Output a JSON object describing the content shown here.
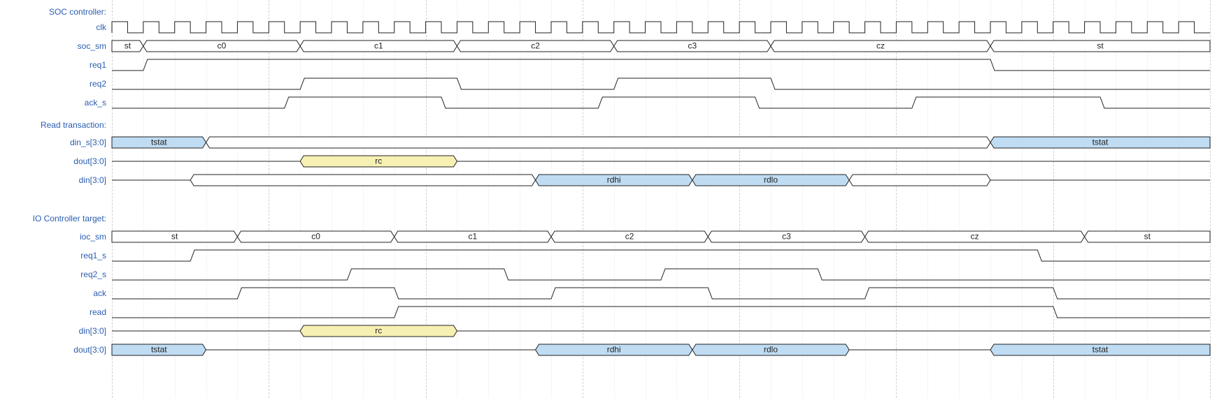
{
  "chart_data": {
    "type": "timing-diagram",
    "clock_cycles": 35,
    "labels": {
      "soc_heading": "SOC controller:",
      "clk": "clk",
      "soc_sm": "soc_sm",
      "req1": "req1",
      "req2": "req2",
      "ack_s": "ack_s",
      "read_txn_heading": "Read transaction:",
      "din_s": "din_s[3:0]",
      "dout": "dout[3:0]",
      "din": "din[3:0]",
      "ioc_heading": "IO Controller target:",
      "ioc_sm": "ioc_sm",
      "req1_s": "req1_s",
      "req2_s": "req2_s",
      "ack": "ack",
      "read": "read",
      "din2": "din[3:0]",
      "dout2": "dout[3:0]"
    },
    "soc_sm_segments": [
      {
        "end": 1,
        "label": "st"
      },
      {
        "end": 6,
        "label": "c0"
      },
      {
        "end": 11,
        "label": "c1"
      },
      {
        "end": 16,
        "label": "c2"
      },
      {
        "end": 21,
        "label": "c3"
      },
      {
        "end": 28,
        "label": "cz"
      },
      {
        "end": 35,
        "label": "st"
      }
    ],
    "ioc_sm_segments": [
      {
        "end": 4,
        "label": "st"
      },
      {
        "end": 9,
        "label": "c0"
      },
      {
        "end": 14,
        "label": "c1"
      },
      {
        "end": 19,
        "label": "c2"
      },
      {
        "end": 24,
        "label": "c3"
      },
      {
        "end": 31,
        "label": "cz"
      },
      {
        "end": 35,
        "label": "st"
      }
    ],
    "din_s_segments": [
      {
        "start": 0,
        "end": 3,
        "label": "tstat",
        "fill": "blue"
      },
      {
        "start": 3,
        "end": 28,
        "label": "",
        "fill": "none"
      },
      {
        "start": 28,
        "end": 35,
        "label": "tstat",
        "fill": "blue"
      }
    ],
    "dout_segments": [
      {
        "start": 0,
        "end": 6,
        "label": "",
        "fill": "flat"
      },
      {
        "start": 6,
        "end": 11,
        "label": "rc",
        "fill": "yellow"
      },
      {
        "start": 11,
        "end": 35,
        "label": "",
        "fill": "flat"
      }
    ],
    "din_segments": [
      {
        "start": 0,
        "end": 2.5,
        "label": "",
        "fill": "flat"
      },
      {
        "start": 2.5,
        "end": 13.5,
        "label": "",
        "fill": "none"
      },
      {
        "start": 13.5,
        "end": 18.5,
        "label": "rdhi",
        "fill": "blue"
      },
      {
        "start": 18.5,
        "end": 23.5,
        "label": "rdlo",
        "fill": "blue"
      },
      {
        "start": 23.5,
        "end": 28,
        "label": "",
        "fill": "none"
      },
      {
        "start": 28,
        "end": 35,
        "label": "",
        "fill": "flat"
      }
    ],
    "din2_segments": [
      {
        "start": 0,
        "end": 6,
        "label": "",
        "fill": "flat"
      },
      {
        "start": 6,
        "end": 11,
        "label": "rc",
        "fill": "yellow"
      },
      {
        "start": 11,
        "end": 35,
        "label": "",
        "fill": "flat"
      }
    ],
    "dout2_segments": [
      {
        "start": 0,
        "end": 3,
        "label": "tstat",
        "fill": "blue"
      },
      {
        "start": 3,
        "end": 13.5,
        "label": "",
        "fill": "flat"
      },
      {
        "start": 13.5,
        "end": 18.5,
        "label": "rdhi",
        "fill": "blue"
      },
      {
        "start": 18.5,
        "end": 23.5,
        "label": "rdlo",
        "fill": "blue"
      },
      {
        "start": 23.5,
        "end": 28,
        "label": "",
        "fill": "flat"
      },
      {
        "start": 28,
        "end": 35,
        "label": "tstat",
        "fill": "blue"
      }
    ],
    "sig_req1": {
      "start_low": 0,
      "rise": 1,
      "fall": 28
    },
    "sig_req2": {
      "pulses": [
        [
          6,
          11
        ],
        [
          16,
          21
        ]
      ]
    },
    "sig_ack_s": {
      "pulses": [
        [
          5.5,
          10.5
        ],
        [
          15.5,
          20.5
        ],
        [
          25.5,
          31.5
        ]
      ]
    },
    "sig_req1_s": {
      "start_low": 0,
      "rise": 2.5,
      "fall": 29.5
    },
    "sig_req2_s": {
      "pulses": [
        [
          7.5,
          12.5
        ],
        [
          17.5,
          22.5
        ]
      ]
    },
    "sig_ack": {
      "pulses": [
        [
          4,
          9
        ],
        [
          14,
          19
        ],
        [
          24,
          30
        ]
      ]
    },
    "sig_read": {
      "start_low": 0,
      "rise": 9,
      "fall": 30
    }
  }
}
